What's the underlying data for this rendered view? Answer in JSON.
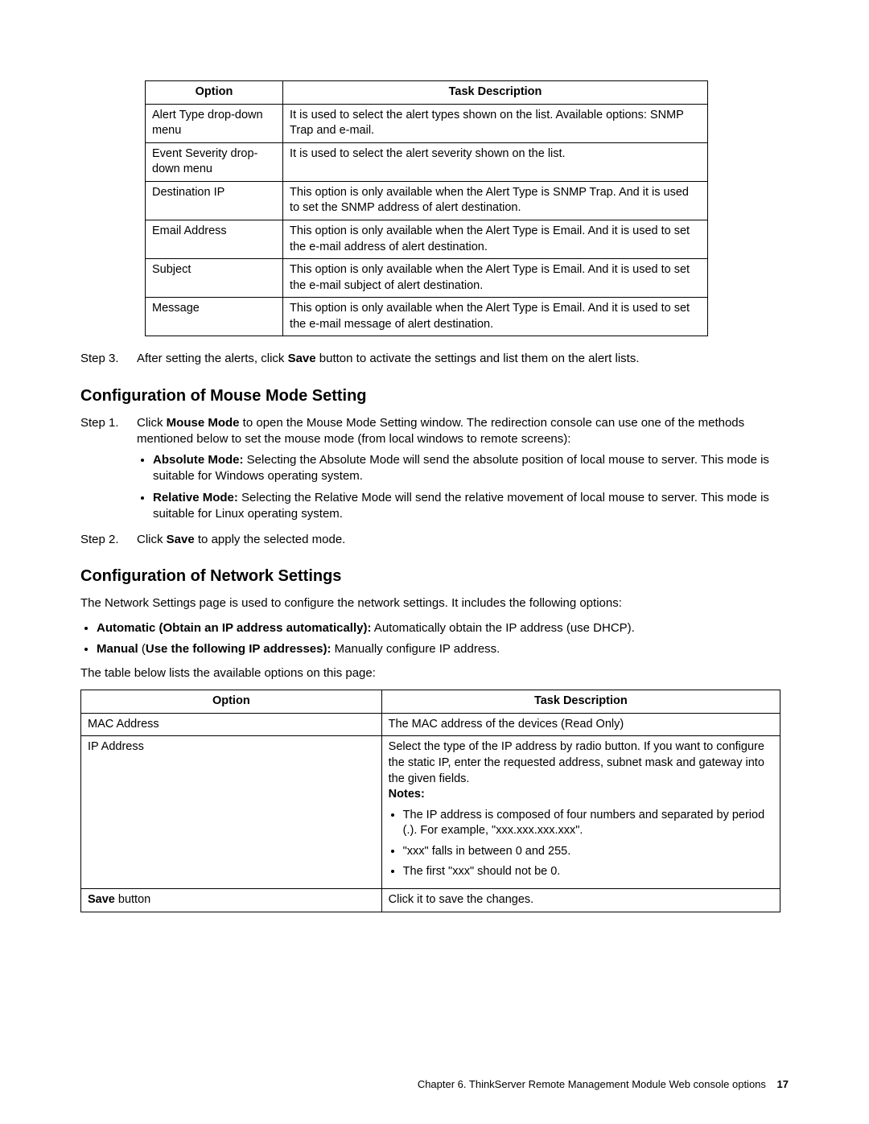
{
  "table1": {
    "headers": [
      "Option",
      "Task Description"
    ],
    "rows": [
      [
        "Alert Type drop-down menu",
        "It is used to select the alert types shown on the list. Available options: SNMP Trap and e-mail."
      ],
      [
        "Event Severity drop-down menu",
        "It is used to select the alert severity shown on the list."
      ],
      [
        "Destination IP",
        "This option is only available when the Alert Type is SNMP Trap. And it is used to set the SNMP address of alert destination."
      ],
      [
        "Email Address",
        "This option is only available when the Alert Type is Email. And it is used to set the e-mail address of alert destination."
      ],
      [
        "Subject",
        "This option is only available when the Alert Type is Email. And it is used to set the e-mail subject of alert destination."
      ],
      [
        "Message",
        "This option is only available when the Alert Type is Email. And it is used to set the e-mail message of alert destination."
      ]
    ]
  },
  "step3": {
    "label": "Step 3.",
    "pre": "After setting the alerts, click ",
    "bold": "Save",
    "post": " button to activate the settings and list them on the alert lists."
  },
  "section_mouse": {
    "heading": "Configuration of Mouse Mode Setting",
    "step1": {
      "label": "Step 1.",
      "pre": "Click ",
      "bold": "Mouse Mode",
      "post": " to open the Mouse Mode Setting window. The redirection console can use one of the methods mentioned below to set the mouse mode (from local windows to remote screens):"
    },
    "bullets": [
      {
        "bold": "Absolute Mode:",
        "text": " Selecting the Absolute Mode will send the absolute position of local mouse to server. This mode is suitable for Windows operating system."
      },
      {
        "bold": "Relative Mode:",
        "text": " Selecting the Relative Mode will send the relative movement of local mouse to server. This mode is suitable for Linux operating system."
      }
    ],
    "step2": {
      "label": "Step 2.",
      "pre": "Click ",
      "bold": "Save",
      "post": " to apply the selected mode."
    }
  },
  "section_network": {
    "heading": "Configuration of Network Settings",
    "intro": "The Network Settings page is used to configure the network settings. It includes the following options:",
    "bullets": [
      {
        "bold": "Automatic (Obtain an IP address automatically):",
        "text": " Automatically obtain the IP address (use DHCP)."
      },
      {
        "bold": "Manual",
        "mid": " (",
        "bold2": "Use the following IP addresses):",
        "text": " Manually configure IP address."
      }
    ],
    "table_intro": "The table below lists the available options on this page:"
  },
  "table2": {
    "headers": [
      "Option",
      "Task Description"
    ],
    "row_mac": [
      "MAC Address",
      "The MAC address of the devices (Read Only)"
    ],
    "row_ip": {
      "opt": "IP Address",
      "desc_pre": "Select the type of the IP address by radio button. If you want to configure the static IP, enter the requested address, subnet mask and gateway into the given fields.",
      "notes_label": "Notes:",
      "notes": [
        "The IP address is composed of four numbers and separated by period (.). For example, \"xxx.xxx.xxx.xxx\".",
        "\"xxx\" falls in between 0 and 255.",
        "The first \"xxx\" should not be 0."
      ]
    },
    "row_save": {
      "opt_bold": "Save",
      "opt_rest": " button",
      "desc": "Click it to save the changes."
    }
  },
  "footer": {
    "text": "Chapter 6. ThinkServer Remote Management Module Web console options",
    "page": "17"
  }
}
